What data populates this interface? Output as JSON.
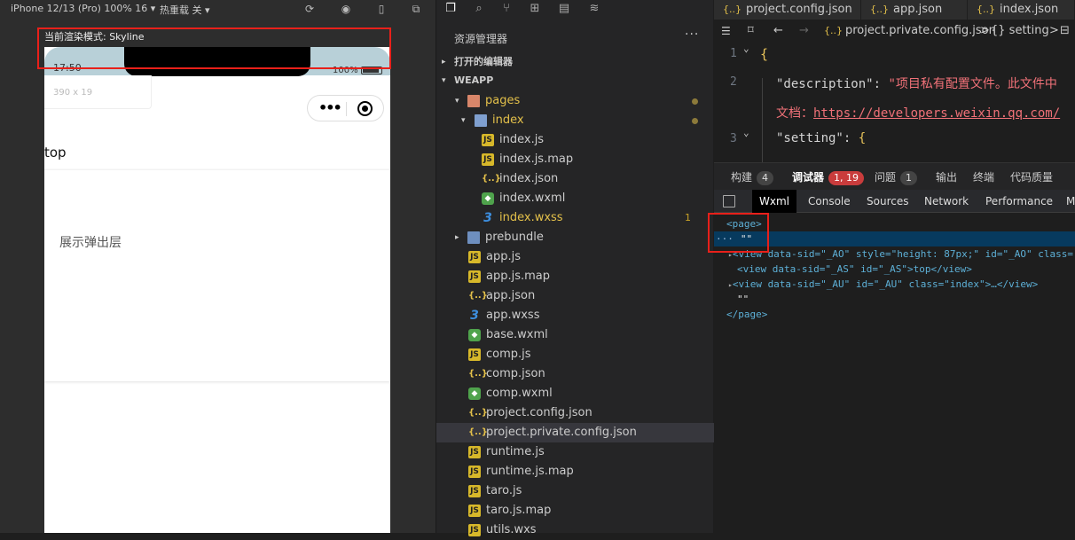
{
  "simulator": {
    "device": "iPhone 12/13 (Pro) 100% 16 ▾",
    "hot_reload": "热重载 关 ▾",
    "render_mode": "当前渲染模式: Skyline",
    "status_time": "17:50",
    "battery_pct": "100%",
    "size_label": "390 x 19",
    "page_text_top": "top",
    "popup_button": "展示弹出层"
  },
  "explorer": {
    "title": "资源管理器",
    "more": "···",
    "open_editors": "打开的编辑器",
    "project": "WEAPP",
    "tree": [
      {
        "name": "pages",
        "type": "folder-open",
        "indent": 1,
        "arrow": "▾",
        "dot": true
      },
      {
        "name": "index",
        "type": "folder-blue",
        "indent": 2,
        "arrow": "▾",
        "dot": true
      },
      {
        "name": "index.js",
        "type": "js",
        "indent": 3
      },
      {
        "name": "index.js.map",
        "type": "js",
        "indent": 3
      },
      {
        "name": "index.json",
        "type": "json",
        "indent": 3
      },
      {
        "name": "index.wxml",
        "type": "wxml",
        "indent": 3
      },
      {
        "name": "index.wxss",
        "type": "wxss",
        "indent": 3,
        "badge": "1"
      },
      {
        "name": "prebundle",
        "type": "folder",
        "indent": 1,
        "arrow": "▸"
      },
      {
        "name": "app.js",
        "type": "js",
        "indent": 2
      },
      {
        "name": "app.js.map",
        "type": "js",
        "indent": 2
      },
      {
        "name": "app.json",
        "type": "json",
        "indent": 2
      },
      {
        "name": "app.wxss",
        "type": "wxss",
        "indent": 2
      },
      {
        "name": "base.wxml",
        "type": "wxml",
        "indent": 2
      },
      {
        "name": "comp.js",
        "type": "js",
        "indent": 2
      },
      {
        "name": "comp.json",
        "type": "json",
        "indent": 2
      },
      {
        "name": "comp.wxml",
        "type": "wxml",
        "indent": 2
      },
      {
        "name": "project.config.json",
        "type": "json",
        "indent": 2
      },
      {
        "name": "project.private.config.json",
        "type": "json",
        "indent": 2,
        "selected": true
      },
      {
        "name": "runtime.js",
        "type": "js",
        "indent": 2
      },
      {
        "name": "runtime.js.map",
        "type": "js",
        "indent": 2
      },
      {
        "name": "taro.js",
        "type": "js",
        "indent": 2
      },
      {
        "name": "taro.js.map",
        "type": "js",
        "indent": 2
      },
      {
        "name": "utils.wxs",
        "type": "js",
        "indent": 2
      }
    ]
  },
  "editor": {
    "tabs": [
      "project.config.json",
      "app.json",
      "index.json"
    ],
    "crumb_file": "project.private.config.json",
    "crumb_sep": ">",
    "crumb_node": "{} setting",
    "code": {
      "l1": "{",
      "l2_key": "\"description\"",
      "l2_val": "\"项目私有配置文件。此文件中",
      "l2b_prefix": "文档：",
      "l2b_url": "https://developers.weixin.qq.com/",
      "l3_key": "\"setting\"",
      "l3_brace": "{"
    }
  },
  "panel": {
    "tabs": [
      {
        "label": "构建",
        "badge": "4"
      },
      {
        "label": "调试器",
        "badge": "1, 19",
        "active": true
      },
      {
        "label": "问题",
        "badge": "1"
      },
      {
        "label": "输出"
      },
      {
        "label": "终端"
      },
      {
        "label": "代码质量"
      }
    ],
    "devtools_tabs": [
      "Wxml",
      "Console",
      "Sources",
      "Network",
      "Performance",
      "M"
    ],
    "wxml": {
      "page_open": "<page>",
      "empty_str": "\"\"",
      "line3": "<view data-sid=\"_AO\" style=\"height: 87px;\" id=\"_AO\" class=",
      "line4": "<view data-sid=\"_AS\" id=\"_AS\">top</view>",
      "line5": "<view data-sid=\"_AU\" id=\"_AU\" class=\"index\">…</view>",
      "empty_str2": "\"\"",
      "page_close": "</page>"
    }
  }
}
